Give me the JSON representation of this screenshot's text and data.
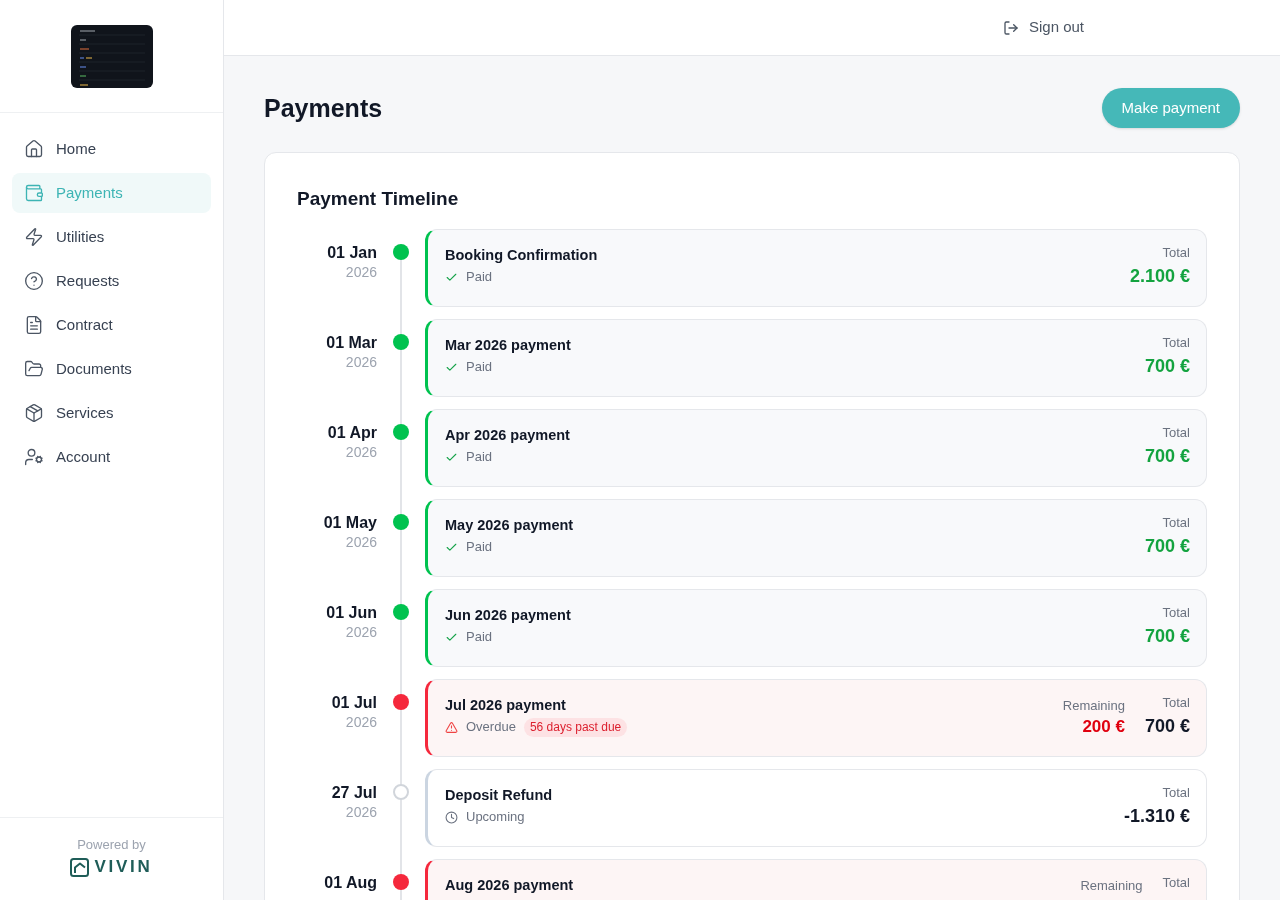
{
  "sidebar": {
    "nav_items": [
      {
        "label": "Home",
        "selected": false
      },
      {
        "label": "Payments",
        "selected": true
      },
      {
        "label": "Utilities",
        "selected": false
      },
      {
        "label": "Requests",
        "selected": false
      },
      {
        "label": "Contract",
        "selected": false
      },
      {
        "label": "Documents",
        "selected": false
      },
      {
        "label": "Services",
        "selected": false
      },
      {
        "label": "Account",
        "selected": false
      }
    ],
    "footer": {
      "powered_by": "Powered by",
      "brand": "VIVIN"
    }
  },
  "header": {
    "sign_out": "Sign out"
  },
  "page": {
    "title": "Payments",
    "action": "Make payment"
  },
  "timeline": {
    "title": "Payment Timeline",
    "entries": [
      {
        "kind": "paid",
        "date": "01 Jan",
        "year": "2026",
        "title": "Booking Confirmation",
        "status_label": "Paid",
        "total_label": "Total",
        "total": "2.100 €"
      },
      {
        "kind": "paid",
        "date": "01 Mar",
        "year": "2026",
        "title": "Mar 2026 payment",
        "status_label": "Paid",
        "total_label": "Total",
        "total": "700 €"
      },
      {
        "kind": "paid",
        "date": "01 Apr",
        "year": "2026",
        "title": "Apr 2026 payment",
        "status_label": "Paid",
        "total_label": "Total",
        "total": "700 €"
      },
      {
        "kind": "paid",
        "date": "01 May",
        "year": "2026",
        "title": "May 2026 payment",
        "status_label": "Paid",
        "total_label": "Total",
        "total": "700 €"
      },
      {
        "kind": "paid",
        "date": "01 Jun",
        "year": "2026",
        "title": "Jun 2026 payment",
        "status_label": "Paid",
        "total_label": "Total",
        "total": "700 €"
      },
      {
        "kind": "overdue",
        "date": "01 Jul",
        "year": "2026",
        "title": "Jul 2026 payment",
        "status_label": "Overdue",
        "badge": "56 days past due",
        "remaining_label": "Remaining",
        "remaining": "200 €",
        "total_label": "Total",
        "total": "700 €"
      },
      {
        "kind": "upcoming",
        "date": "27 Jul",
        "year": "2026",
        "title": "Deposit Refund",
        "status_label": "Upcoming",
        "total_label": "Total",
        "total": "-1.310 €"
      },
      {
        "kind": "overdue",
        "date": "01 Aug",
        "title": "Aug 2026 payment",
        "remaining_label": "Remaining",
        "total_label": "Total"
      }
    ]
  }
}
